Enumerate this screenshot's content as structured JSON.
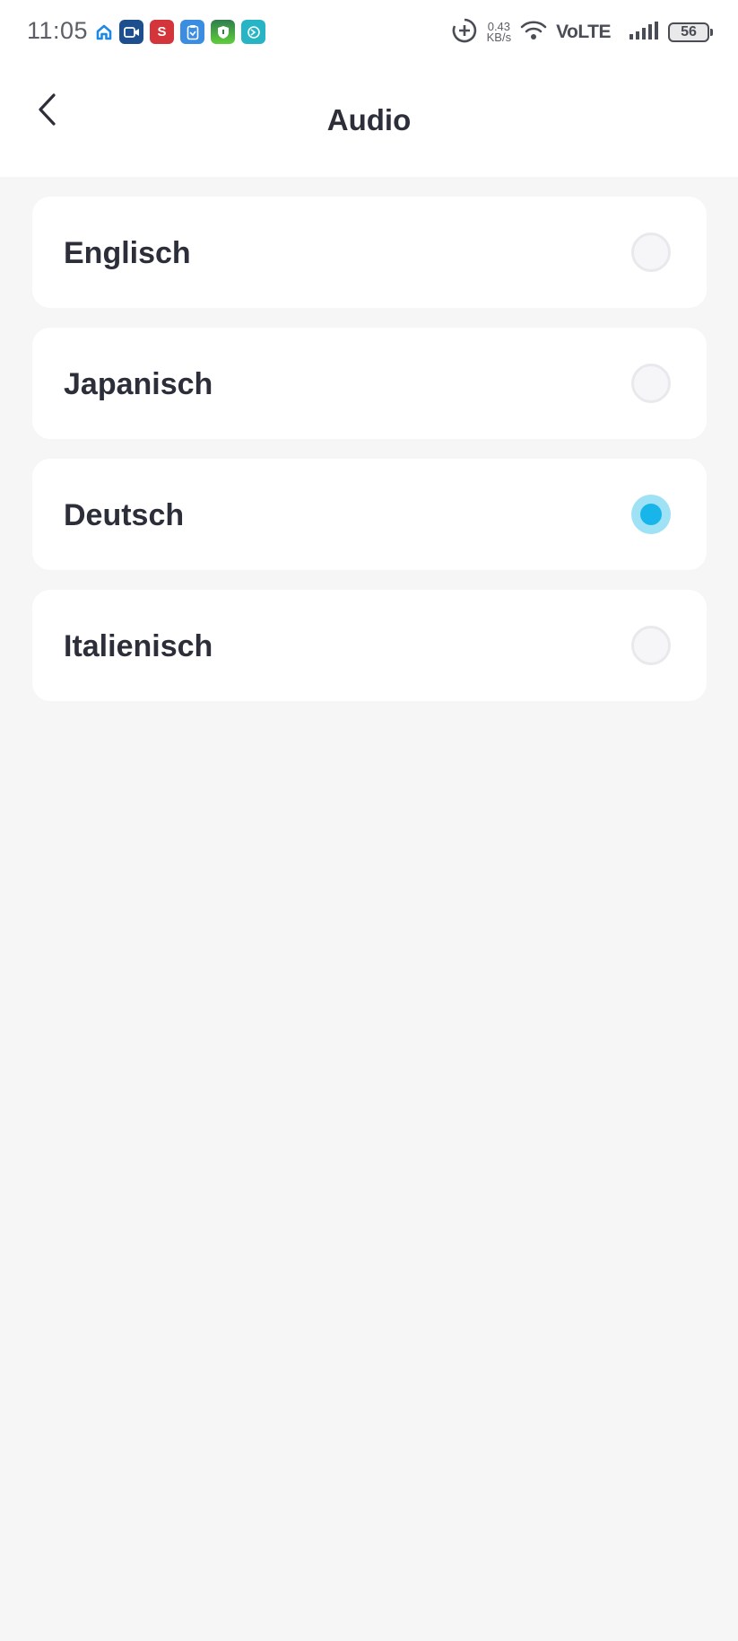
{
  "status_bar": {
    "time": "11:05",
    "net_speed_value": "0.43",
    "net_speed_unit": "KB/s",
    "network_label": "VoLTE",
    "battery": "56",
    "app_icons": [
      {
        "name": "home-app-icon",
        "color": "#1e88e5"
      },
      {
        "name": "video-app-icon",
        "color": "#1d4f8f",
        "glyph": "▭"
      },
      {
        "name": "s-app-icon",
        "color": "#d3353b",
        "glyph": "S"
      },
      {
        "name": "clipboard-app-icon",
        "color": "#3a8de0",
        "glyph": "▤"
      },
      {
        "name": "shield-app-icon",
        "color": "#44b543",
        "glyph": "⛨"
      },
      {
        "name": "swirl-app-icon",
        "color": "#27b4c4",
        "glyph": "◎"
      }
    ]
  },
  "header": {
    "title": "Audio",
    "back_icon": "chevron-left-icon"
  },
  "options": [
    {
      "label": "Englisch",
      "selected": false
    },
    {
      "label": "Japanisch",
      "selected": false
    },
    {
      "label": "Deutsch",
      "selected": true
    },
    {
      "label": "Italienisch",
      "selected": false
    }
  ],
  "colors": {
    "accent": "#17b5ea",
    "accent_halo": "#9fe2f6",
    "background": "#f6f6f7",
    "text": "#2c2e39"
  }
}
